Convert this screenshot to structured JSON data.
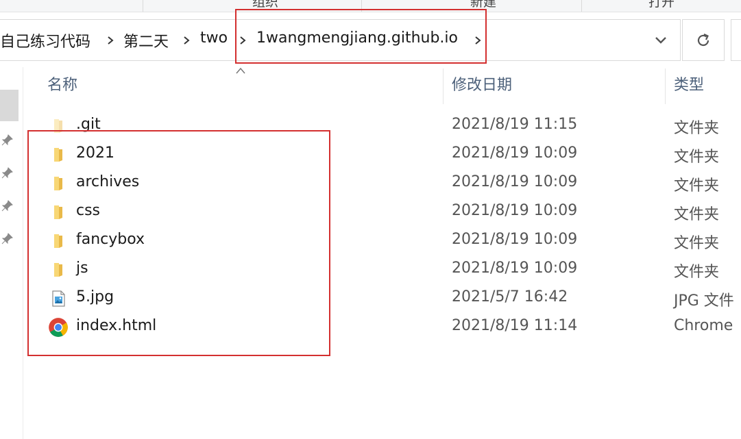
{
  "ribbon": {
    "group1": "组织",
    "group2": "新建",
    "group3": "打开"
  },
  "address_bar": {
    "crumbs": [
      "自己练习代码",
      "第二天",
      "two",
      "1wangmengjiang.github.io"
    ]
  },
  "columns": {
    "name": "名称",
    "date": "修改日期",
    "type": "类型"
  },
  "files": [
    {
      "name": ".git",
      "date": "2021/8/19 11:15",
      "type": "文件夹",
      "icon": "folder-icon",
      "faded": true
    },
    {
      "name": "2021",
      "date": "2021/8/19 10:09",
      "type": "文件夹",
      "icon": "folder-icon"
    },
    {
      "name": "archives",
      "date": "2021/8/19 10:09",
      "type": "文件夹",
      "icon": "folder-icon"
    },
    {
      "name": "css",
      "date": "2021/8/19 10:09",
      "type": "文件夹",
      "icon": "folder-icon"
    },
    {
      "name": "fancybox",
      "date": "2021/8/19 10:09",
      "type": "文件夹",
      "icon": "folder-icon"
    },
    {
      "name": "js",
      "date": "2021/8/19 10:09",
      "type": "文件夹",
      "icon": "folder-icon"
    },
    {
      "name": "5.jpg",
      "date": "2021/5/7 16:42",
      "type": "JPG 文件",
      "icon": "image-file-icon"
    },
    {
      "name": "index.html",
      "date": "2021/8/19 11:14",
      "type": "Chrome",
      "icon": "chrome-icon"
    }
  ],
  "colors": {
    "highlight": "#d32f2f",
    "header_text": "#4c607a",
    "folder": "#f8d775"
  }
}
